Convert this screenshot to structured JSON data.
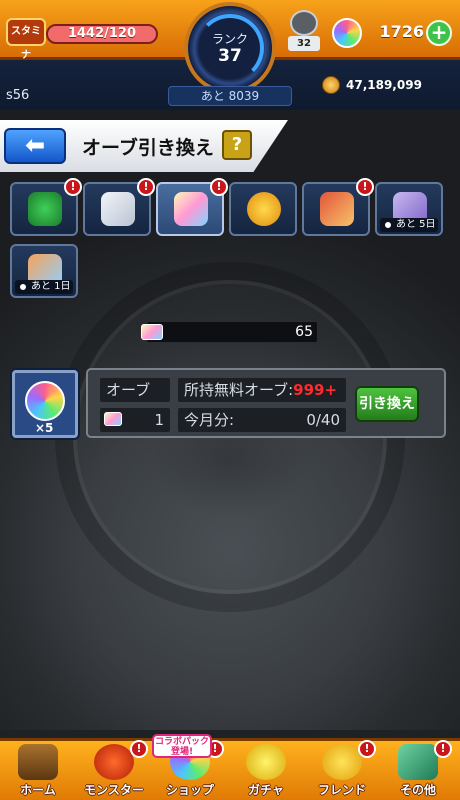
{
  "header": {
    "stamina_label": "スタミナ",
    "stamina_value": "1442/120",
    "rank_label": "ランク",
    "rank_value": "37",
    "rank_remaining": "あと 8039",
    "gear_count": "32",
    "orb_count": "1726",
    "plus_label": "+",
    "player_id": "s56",
    "coin_count": "47,189,099"
  },
  "title_bar": {
    "back_label": "⬅",
    "title": "オーブ引き換え",
    "help_label": "?"
  },
  "tiles": [
    {
      "name": "clover-item",
      "badge": "!"
    },
    {
      "name": "gift-item",
      "badge": "!"
    },
    {
      "name": "orb-ticket",
      "badge": "!"
    },
    {
      "name": "monster-egg",
      "badge": ""
    },
    {
      "name": "box-item",
      "badge": "!"
    },
    {
      "name": "card-item",
      "badge": "",
      "timer": "あと 5日"
    },
    {
      "name": "exchange-item",
      "badge": "",
      "timer": "あと 1日"
    }
  ],
  "ticket": {
    "count": "65"
  },
  "exchange": {
    "orb_multiplier": "×5",
    "orb_label": "オーブ",
    "ticket_cost": "1",
    "owned_free_label": "所持無料オーブ:",
    "owned_free_value": "999+",
    "monthly_label": "今月分:",
    "monthly_value": "0/40",
    "exchange_button": "引き換え"
  },
  "bottom_nav": {
    "items": [
      {
        "label": "ホーム",
        "badge": ""
      },
      {
        "label": "モンスター",
        "badge": "!"
      },
      {
        "label": "ショップ",
        "badge": "!"
      },
      {
        "label": "ガチャ",
        "badge": ""
      },
      {
        "label": "フレンド",
        "badge": "!"
      },
      {
        "label": "その他",
        "badge": "!"
      }
    ],
    "collab_badge": "コラボパック登場!"
  }
}
